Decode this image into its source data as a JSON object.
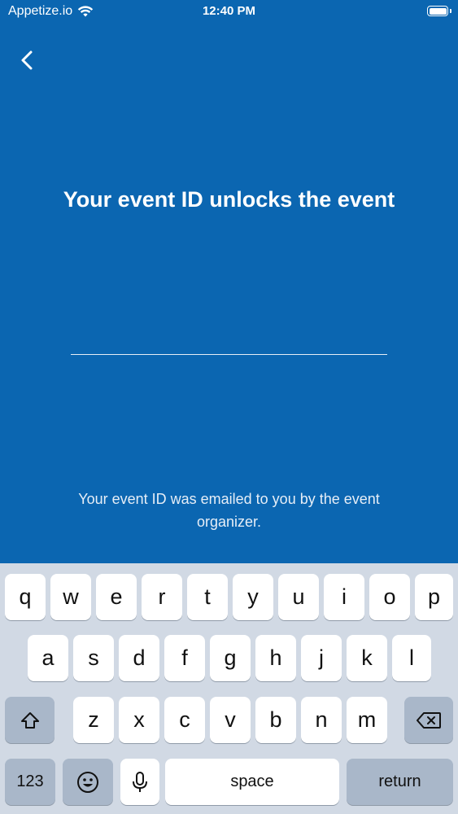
{
  "status": {
    "carrier": "Appetize.io",
    "time": "12:40 PM",
    "icons": [
      "wifi-icon",
      "battery-icon"
    ]
  },
  "nav": {
    "back_icon": "chevron-left-icon"
  },
  "screen": {
    "title": "Your event ID unlocks the event",
    "input": {
      "value": "",
      "placeholder": ""
    },
    "hint": "Your event ID was emailed to you by the event organizer."
  },
  "keyboard": {
    "row1": [
      "q",
      "w",
      "e",
      "r",
      "t",
      "y",
      "u",
      "i",
      "o",
      "p"
    ],
    "row2": [
      "a",
      "s",
      "d",
      "f",
      "g",
      "h",
      "j",
      "k",
      "l"
    ],
    "row3": [
      "z",
      "x",
      "c",
      "v",
      "b",
      "n",
      "m"
    ],
    "numbers_label": "123",
    "space_label": "space",
    "return_label": "return",
    "shift_icon": "shift-icon",
    "delete_icon": "backspace-icon",
    "emoji_icon": "emoji-icon",
    "mic_icon": "microphone-icon"
  },
  "colors": {
    "background": "#0b66b1",
    "keyboard_bg": "#d1d9e4",
    "key": "#ffffff",
    "key_dark": "#a9b7c9"
  }
}
